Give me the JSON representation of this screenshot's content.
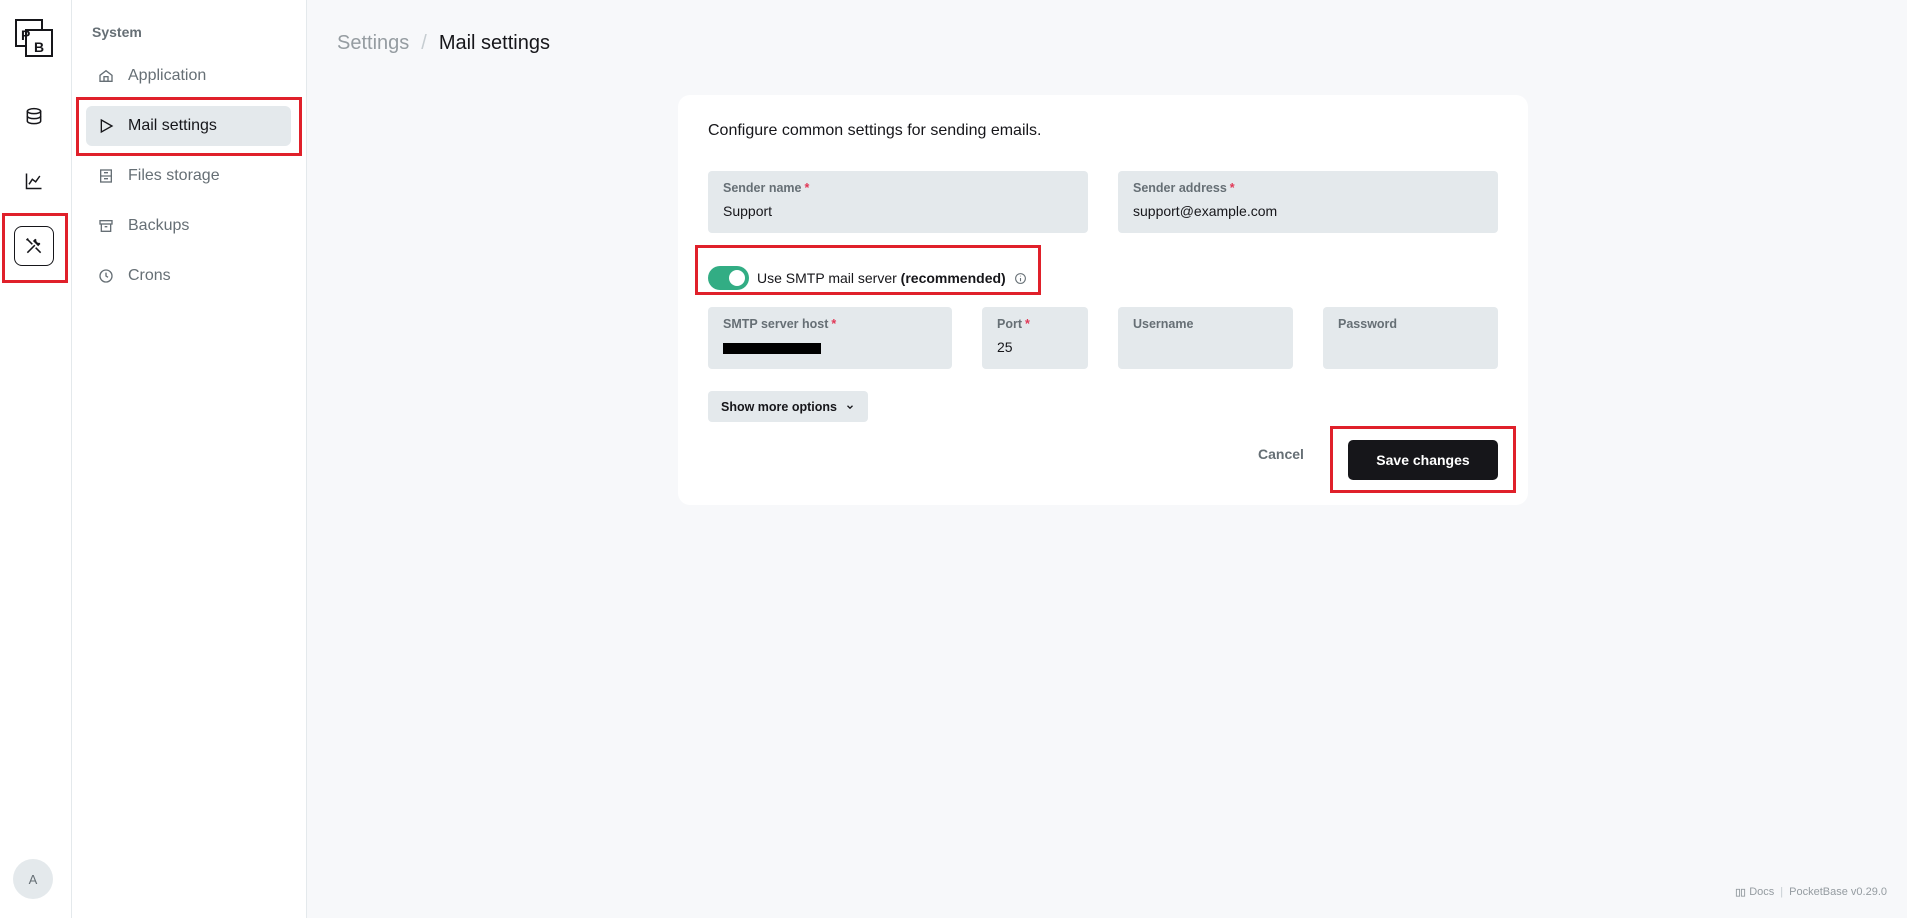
{
  "rail": {
    "logo_letters": [
      "P",
      "B"
    ],
    "items": [
      {
        "icon": "database-icon"
      },
      {
        "icon": "chart-line-icon"
      },
      {
        "icon": "tools-icon",
        "active": true
      }
    ],
    "avatar_letter": "A"
  },
  "sidebar": {
    "section_title": "System",
    "items": [
      {
        "label": "Application",
        "icon": "home-icon"
      },
      {
        "label": "Mail settings",
        "icon": "send-icon",
        "active": true
      },
      {
        "label": "Files storage",
        "icon": "storage-icon"
      },
      {
        "label": "Backups",
        "icon": "archive-icon"
      },
      {
        "label": "Crons",
        "icon": "clock-icon"
      }
    ]
  },
  "breadcrumb": {
    "parent": "Settings",
    "separator": "/",
    "current": "Mail settings"
  },
  "panel": {
    "intro": "Configure common settings for sending emails.",
    "sender_name": {
      "label": "Sender name",
      "value": "Support",
      "required_mark": "*"
    },
    "sender_address": {
      "label": "Sender address",
      "value": "support@example.com",
      "required_mark": "*"
    },
    "smtp_toggle": {
      "label": "Use SMTP mail server",
      "bold": "(recommended)",
      "enabled": true
    },
    "smtp_host": {
      "label": "SMTP server host",
      "required_mark": "*"
    },
    "port": {
      "label": "Port",
      "value": "25",
      "required_mark": "*"
    },
    "username": {
      "label": "Username",
      "value": ""
    },
    "password": {
      "label": "Password",
      "value": ""
    },
    "more_options_label": "Show more options",
    "cancel_label": "Cancel",
    "save_label": "Save changes"
  },
  "footer": {
    "docs_label": "Docs",
    "separator": "|",
    "version": "PocketBase v0.29.0"
  },
  "colors": {
    "accent": "#32ad84",
    "highlight": "#e0202a",
    "primary_button": "#16161a"
  }
}
